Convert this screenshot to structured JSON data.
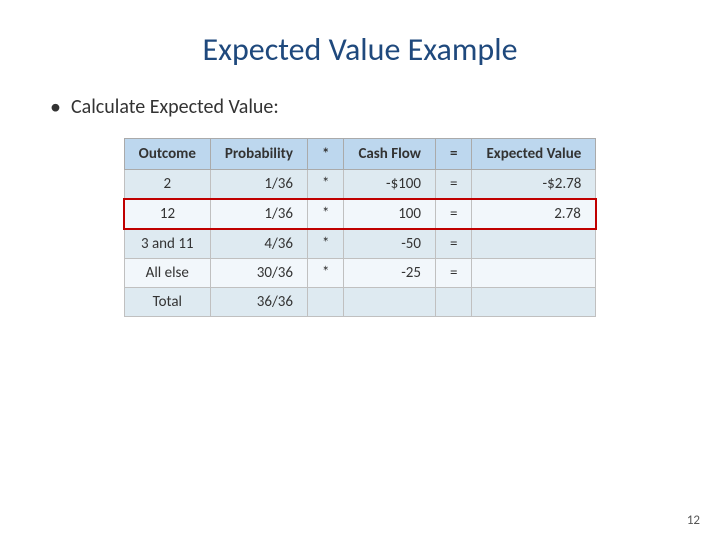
{
  "slide": {
    "title": "Expected Value Example",
    "bullet": "Calculate Expected Value:",
    "table": {
      "headers": [
        "Outcome",
        "Probability",
        "*",
        "Cash Flow",
        "=",
        "Expected Value"
      ],
      "rows": [
        {
          "outcome": "2",
          "probability": "1/36",
          "star": "*",
          "cashflow": "-$100",
          "eq": "=",
          "ev": "-$2.78",
          "highlighted": false
        },
        {
          "outcome": "12",
          "probability": "1/36",
          "star": "*",
          "cashflow": "100",
          "eq": "=",
          "ev": "2.78",
          "highlighted": true
        },
        {
          "outcome": "3 and 11",
          "probability": "4/36",
          "star": "*",
          "cashflow": "-50",
          "eq": "=",
          "ev": "",
          "highlighted": false
        },
        {
          "outcome": "All else",
          "probability": "30/36",
          "star": "*",
          "cashflow": "-25",
          "eq": "=",
          "ev": "",
          "highlighted": false
        },
        {
          "outcome": "Total",
          "probability": "36/36",
          "star": "",
          "cashflow": "",
          "eq": "",
          "ev": "",
          "highlighted": false
        }
      ]
    },
    "page_number": "12"
  }
}
